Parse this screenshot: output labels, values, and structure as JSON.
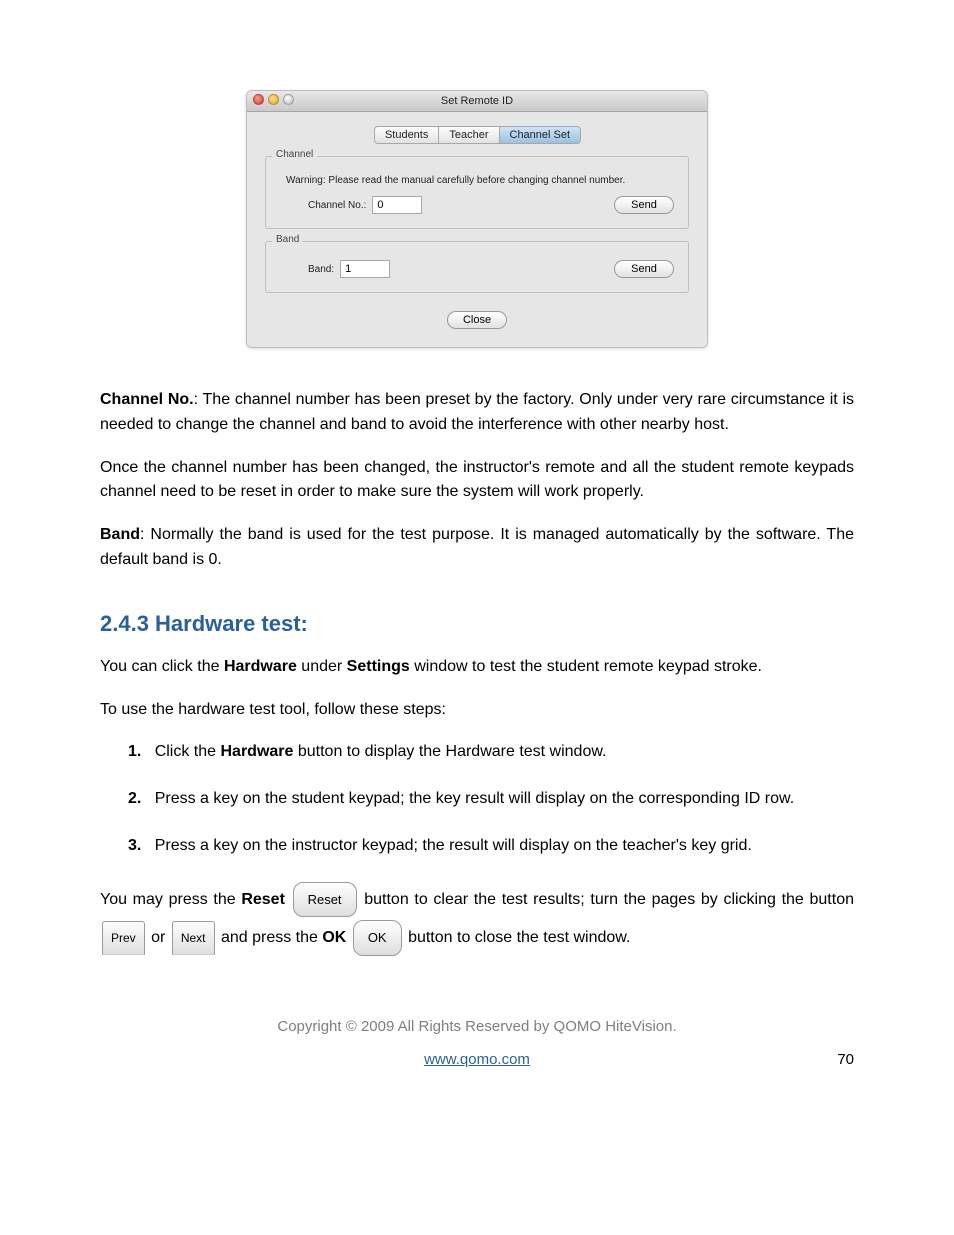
{
  "window": {
    "title": "Set Remote ID",
    "tabs": {
      "students": "Students",
      "teacher": "Teacher",
      "channel_set": "Channel Set"
    },
    "channel_group": {
      "legend": "Channel",
      "warning": "Warning: Please read the manual carefully before changing channel number.",
      "label": "Channel No.:",
      "value": "0",
      "send": "Send"
    },
    "band_group": {
      "legend": "Band",
      "label": "Band:",
      "value": "1",
      "send": "Send"
    },
    "close": "Close"
  },
  "body": {
    "p1_bold": "Channel No.",
    "p1_rest": ": The channel number has been preset by the factory. Only under very rare circumstance it is needed to change the channel and band to avoid the interference with other nearby host.",
    "p2": "Once the channel number has been changed, the instructor's remote and all the student remote keypads channel need to be reset in order to make sure the system will work properly.",
    "p3_bold": "Band",
    "p3_rest": ": Normally the band is used for the test purpose. It is managed automatically by the software. The default band is 0.",
    "heading": "2.4.3  Hardware test:",
    "p4_a": "You can click the ",
    "p4_b": "Hardware",
    "p4_c": " under ",
    "p4_d": "Settings",
    "p4_e": " window to test the student remote keypad stroke.",
    "p5": "To use the hardware test tool, follow these steps:",
    "steps": {
      "s1a": "Click the ",
      "s1b": "Hardware",
      "s1c": " button to display the Hardware test window.",
      "s2": "Press a key on the student keypad; the key result will display on the corresponding ID row.",
      "s3": "Press a key on the instructor keypad; the result will display on the teacher's key grid."
    },
    "last": {
      "a": "You may press the ",
      "reset_bold": "Reset",
      "reset_btn": "Reset",
      "b": " button to clear the test results; turn the pages by clicking the button ",
      "prev_btn": "Prev",
      "c": " or ",
      "next_btn": "Next",
      "d": " and press the ",
      "ok_bold": "OK",
      "ok_btn": "OK",
      "e": " button to close the test window."
    }
  },
  "footer": {
    "copyright": "Copyright © 2009 All Rights Reserved by QOMO HiteVision.",
    "link": "www.qomo.com",
    "page": "70"
  }
}
